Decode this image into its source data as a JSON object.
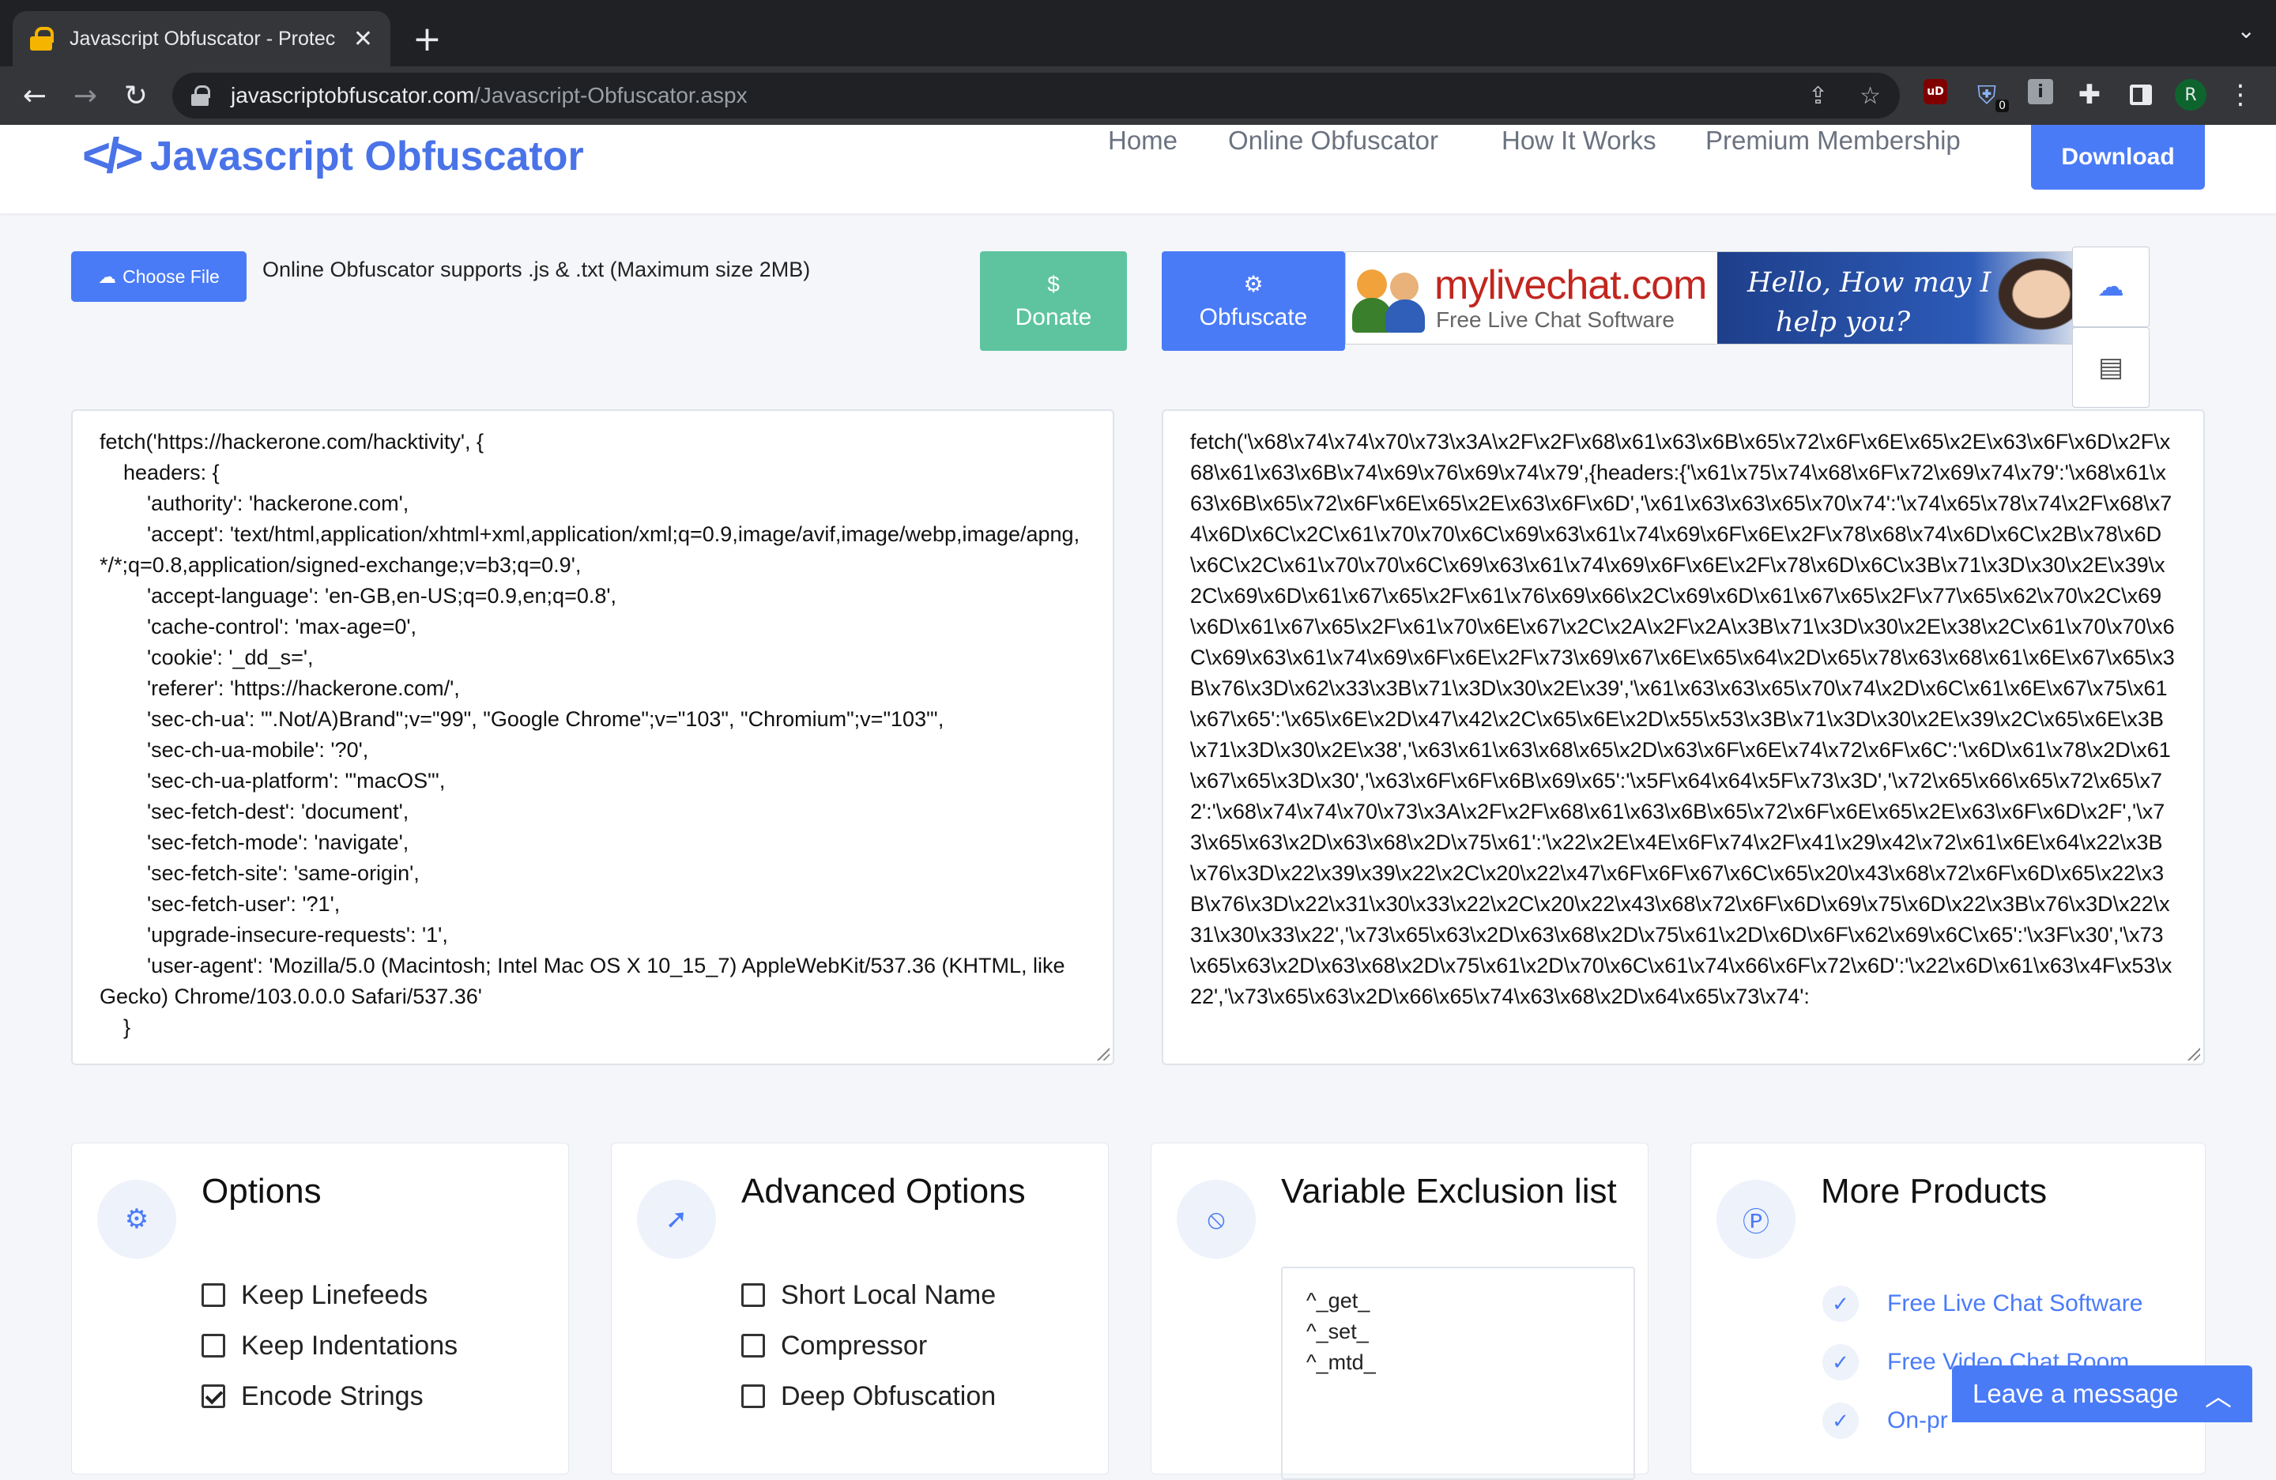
{
  "browser": {
    "tab_title": "Javascript Obfuscator - Protec",
    "tab_close": "✕",
    "new_tab": "+",
    "tab_menu": "⌄",
    "url_host": "javascriptobfuscator.com",
    "url_path": "/Javascript-Obfuscator.aspx",
    "ext_ublock": "uD",
    "ext_badge": "0",
    "ext_info": "i",
    "profile_initial": "R"
  },
  "header": {
    "logo_mark": "</>",
    "logo_text": "Javascript Obfuscator",
    "nav": [
      "Home",
      "Online Obfuscator",
      "How It Works",
      "Premium Membership"
    ],
    "download": "Download"
  },
  "actions": {
    "choose_file": "Choose File",
    "support_text": "Online Obfuscator supports .js & .txt (Maximum size 2MB)",
    "donate": "Donate",
    "obfuscate": "Obfuscate"
  },
  "banner": {
    "brand": "mylivechat.com",
    "tagline": "Free Live Chat Software",
    "hello_line1": "Hello, How may I",
    "hello_line2": "help you?"
  },
  "input_code": "fetch('https://hackerone.com/hacktivity', {\n    headers: {\n        'authority': 'hackerone.com',\n        'accept': 'text/html,application/xhtml+xml,application/xml;q=0.9,image/avif,image/webp,image/apng,*/*;q=0.8,application/signed-exchange;v=b3;q=0.9',\n        'accept-language': 'en-GB,en-US;q=0.9,en;q=0.8',\n        'cache-control': 'max-age=0',\n        'cookie': '_dd_s=',\n        'referer': 'https://hackerone.com/',\n        'sec-ch-ua': '\".Not/A)Brand\";v=\"99\", \"Google Chrome\";v=\"103\", \"Chromium\";v=\"103\"',\n        'sec-ch-ua-mobile': '?0',\n        'sec-ch-ua-platform': '\"macOS\"',\n        'sec-fetch-dest': 'document',\n        'sec-fetch-mode': 'navigate',\n        'sec-fetch-site': 'same-origin',\n        'sec-fetch-user': '?1',\n        'upgrade-insecure-requests': '1',\n        'user-agent': 'Mozilla/5.0 (Macintosh; Intel Mac OS X 10_15_7) AppleWebKit/537.36 (KHTML, like Gecko) Chrome/103.0.0.0 Safari/537.36'\n    }",
  "output_code": "fetch('\\x68\\x74\\x74\\x70\\x73\\x3A\\x2F\\x2F\\x68\\x61\\x63\\x6B\\x65\\x72\\x6F\\x6E\\x65\\x2E\\x63\\x6F\\x6D\\x2F\\x68\\x61\\x63\\x6B\\x74\\x69\\x76\\x69\\x74\\x79',{headers:{'\\x61\\x75\\x74\\x68\\x6F\\x72\\x69\\x74\\x79':'\\x68\\x61\\x63\\x6B\\x65\\x72\\x6F\\x6E\\x65\\x2E\\x63\\x6F\\x6D','\\x61\\x63\\x63\\x65\\x70\\x74':'\\x74\\x65\\x78\\x74\\x2F\\x68\\x74\\x6D\\x6C\\x2C\\x61\\x70\\x70\\x6C\\x69\\x63\\x61\\x74\\x69\\x6F\\x6E\\x2F\\x78\\x68\\x74\\x6D\\x6C\\x2B\\x78\\x6D\\x6C\\x2C\\x61\\x70\\x70\\x6C\\x69\\x63\\x61\\x74\\x69\\x6F\\x6E\\x2F\\x78\\x6D\\x6C\\x3B\\x71\\x3D\\x30\\x2E\\x39\\x2C\\x69\\x6D\\x61\\x67\\x65\\x2F\\x61\\x76\\x69\\x66\\x2C\\x69\\x6D\\x61\\x67\\x65\\x2F\\x77\\x65\\x62\\x70\\x2C\\x69\\x6D\\x61\\x67\\x65\\x2F\\x61\\x70\\x6E\\x67\\x2C\\x2A\\x2F\\x2A\\x3B\\x71\\x3D\\x30\\x2E\\x38\\x2C\\x61\\x70\\x70\\x6C\\x69\\x63\\x61\\x74\\x69\\x6F\\x6E\\x2F\\x73\\x69\\x67\\x6E\\x65\\x64\\x2D\\x65\\x78\\x63\\x68\\x61\\x6E\\x67\\x65\\x3B\\x76\\x3D\\x62\\x33\\x3B\\x71\\x3D\\x30\\x2E\\x39','\\x61\\x63\\x63\\x65\\x70\\x74\\x2D\\x6C\\x61\\x6E\\x67\\x75\\x61\\x67\\x65':'\\x65\\x6E\\x2D\\x47\\x42\\x2C\\x65\\x6E\\x2D\\x55\\x53\\x3B\\x71\\x3D\\x30\\x2E\\x39\\x2C\\x65\\x6E\\x3B\\x71\\x3D\\x30\\x2E\\x38','\\x63\\x61\\x63\\x68\\x65\\x2D\\x63\\x6F\\x6E\\x74\\x72\\x6F\\x6C':'\\x6D\\x61\\x78\\x2D\\x61\\x67\\x65\\x3D\\x30','\\x63\\x6F\\x6F\\x6B\\x69\\x65':'\\x5F\\x64\\x64\\x5F\\x73\\x3D','\\x72\\x65\\x66\\x65\\x72\\x65\\x72':'\\x68\\x74\\x74\\x70\\x73\\x3A\\x2F\\x2F\\x68\\x61\\x63\\x6B\\x65\\x72\\x6F\\x6E\\x65\\x2E\\x63\\x6F\\x6D\\x2F','\\x73\\x65\\x63\\x2D\\x63\\x68\\x2D\\x75\\x61':'\\x22\\x2E\\x4E\\x6F\\x74\\x2F\\x41\\x29\\x42\\x72\\x61\\x6E\\x64\\x22\\x3B\\x76\\x3D\\x22\\x39\\x39\\x22\\x2C\\x20\\x22\\x47\\x6F\\x6F\\x67\\x6C\\x65\\x20\\x43\\x68\\x72\\x6F\\x6D\\x65\\x22\\x3B\\x76\\x3D\\x22\\x31\\x30\\x33\\x22\\x2C\\x20\\x22\\x43\\x68\\x72\\x6F\\x6D\\x69\\x75\\x6D\\x22\\x3B\\x76\\x3D\\x22\\x31\\x30\\x33\\x22','\\x73\\x65\\x63\\x2D\\x63\\x68\\x2D\\x75\\x61\\x2D\\x6D\\x6F\\x62\\x69\\x6C\\x65':'\\x3F\\x30','\\x73\\x65\\x63\\x2D\\x63\\x68\\x2D\\x75\\x61\\x2D\\x70\\x6C\\x61\\x74\\x66\\x6F\\x72\\x6D':'\\x22\\x6D\\x61\\x63\\x4F\\x53\\x22','\\x73\\x65\\x63\\x2D\\x66\\x65\\x74\\x63\\x68\\x2D\\x64\\x65\\x73\\x74':",
  "options": {
    "title": "Options",
    "items": [
      {
        "label": "Keep Linefeeds",
        "checked": false
      },
      {
        "label": "Keep Indentations",
        "checked": false
      },
      {
        "label": "Encode Strings",
        "checked": true
      }
    ]
  },
  "advanced": {
    "title": "Advanced Options",
    "items": [
      {
        "label": "Short Local Name",
        "checked": false
      },
      {
        "label": "Compressor",
        "checked": false
      },
      {
        "label": "Deep Obfuscation",
        "checked": false
      }
    ]
  },
  "exclusion": {
    "title": "Variable Exclusion list",
    "items": [
      "^_get_",
      "^_set_",
      "^_mtd_"
    ]
  },
  "products": {
    "title": "More Products",
    "items": [
      "Free Live Chat Software",
      "Free Video Chat Room",
      "On-pr"
    ]
  },
  "chat_widget": {
    "label": "Leave a message"
  },
  "colors": {
    "primary": "#4a7bf7",
    "donate": "#5ec4a0",
    "chrome_bg": "#202124"
  }
}
